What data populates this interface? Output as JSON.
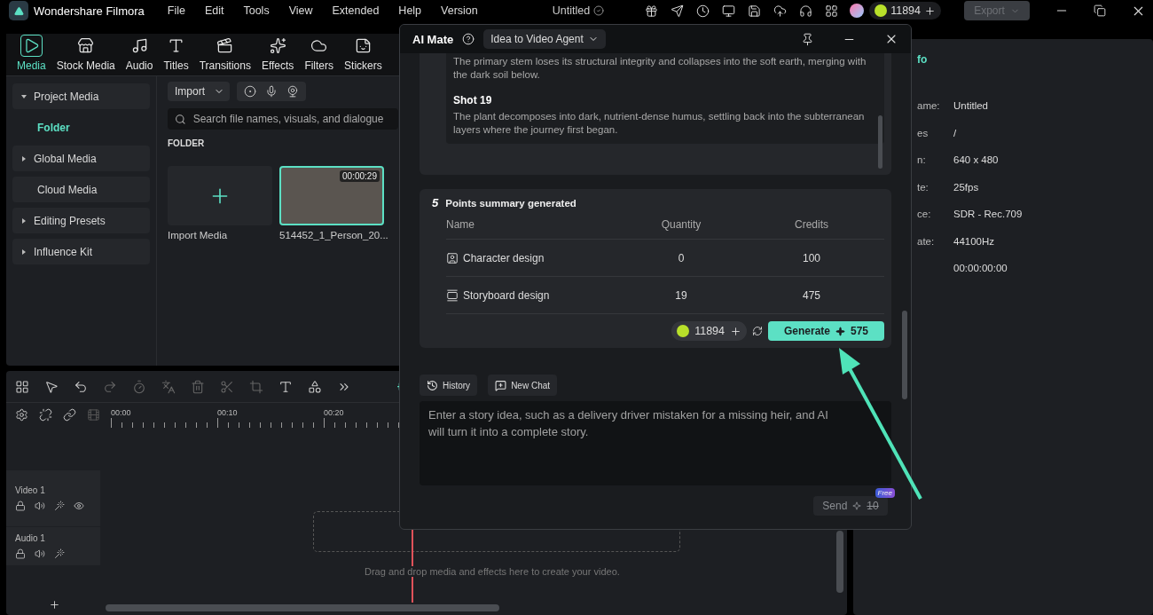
{
  "app": {
    "name": "Wondershare Filmora"
  },
  "menu": [
    "File",
    "Edit",
    "Tools",
    "View",
    "Extended",
    "Help",
    "Version"
  ],
  "project_title": "Untitled",
  "credits": "11894",
  "export_button": {
    "label": "Export",
    "disabled": true
  },
  "toolbar_tabs": [
    {
      "label": "Media",
      "selected": true
    },
    {
      "label": "Stock Media",
      "selected": false
    },
    {
      "label": "Audio",
      "selected": false
    },
    {
      "label": "Titles",
      "selected": false
    },
    {
      "label": "Transitions",
      "selected": false
    },
    {
      "label": "Effects",
      "selected": false
    },
    {
      "label": "Filters",
      "selected": false
    },
    {
      "label": "Stickers",
      "selected": false
    }
  ],
  "sidebar": {
    "items": [
      {
        "kind": "group",
        "label": "Project Media",
        "expanded": true,
        "children": [
          {
            "label": "Folder",
            "selected": true
          }
        ]
      },
      {
        "kind": "group",
        "label": "Global Media",
        "expanded": false
      },
      {
        "kind": "plain",
        "label": "Cloud Media"
      },
      {
        "kind": "group",
        "label": "Editing Presets",
        "expanded": false
      },
      {
        "kind": "group",
        "label": "Influence Kit",
        "expanded": false
      }
    ]
  },
  "media": {
    "import_button": "Import",
    "search": {
      "placeholder": "Search file names, visuals, and dialogue"
    },
    "section": "FOLDER",
    "tiles": [
      {
        "kind": "import",
        "label": "Import Media"
      },
      {
        "kind": "clip",
        "label": "514452_1_Person_20...",
        "duration": "00:00:29",
        "selected": true
      }
    ]
  },
  "timeline": {
    "ruler": [
      "00:00",
      "00:10",
      "00:20"
    ],
    "tracks": [
      {
        "kind": "video",
        "label": "Video 1"
      },
      {
        "kind": "audio",
        "label": "Audio 1"
      }
    ],
    "drop_hint": "Drag and drop media and effects here to create your video."
  },
  "properties": {
    "header": "fo",
    "rows": [
      {
        "label": "ame:",
        "value": "Untitled"
      },
      {
        "label": "es",
        "value": "/"
      },
      {
        "label": "n:",
        "value": "640 x 480"
      },
      {
        "label": "te:",
        "value": "25fps"
      },
      {
        "label": "ce:",
        "value": "SDR - Rec.709"
      },
      {
        "label": "ate:",
        "value": "44100Hz"
      },
      {
        "value": "00:00:00:00"
      }
    ]
  },
  "ai_mate": {
    "title": "AI Mate",
    "mode": "Idea to Video Agent",
    "story": [
      {
        "text": "The primary stem loses its structural integrity and collapses into the soft earth, merging with the dark soil below."
      },
      {
        "heading": "Shot 19",
        "text": "The plant decomposes into dark, nutrient-dense humus, settling back into the subterranean layers where the journey first began."
      }
    ],
    "summary": {
      "step": "5",
      "title": "Points summary generated",
      "columns": [
        "Name",
        "Quantity",
        "Credits"
      ],
      "rows": [
        {
          "kind": "character",
          "name": "Character design",
          "quantity": "0",
          "credits": "100"
        },
        {
          "kind": "storyboard",
          "name": "Storyboard design",
          "quantity": "19",
          "credits": "475"
        }
      ],
      "balance": "11894",
      "generate_button": {
        "label": "Generate",
        "cost": "575"
      }
    },
    "history_button": "History",
    "new_chat_button": "New Chat",
    "input": {
      "placeholder": "Enter a story idea, such as a delivery driver mistaken for a missing heir, and AI will turn it into a complete story."
    },
    "send_button": {
      "label": "Send",
      "old_cost": "10",
      "badge": "Free",
      "disabled": true
    }
  }
}
